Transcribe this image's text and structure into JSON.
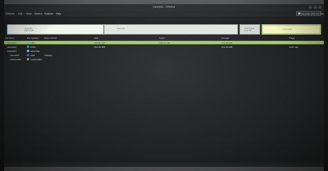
{
  "window": {
    "title": "/dev/sdb - GParted"
  },
  "menu": [
    "GParted",
    "Edit",
    "View",
    "Device",
    "Partition",
    "Help"
  ],
  "device": {
    "label": "/dev/sdb (931.51 GiB)"
  },
  "diskmap": {
    "partitions": [
      {
        "name": "/dev/sdb1",
        "size": "476.91 GiB"
      },
      {
        "name": "/dev/sdb2",
        "size": "...."
      },
      {
        "name": "unallocated",
        "size": "5.15 GiB"
      },
      {
        "name": "unallocated",
        "size": ""
      }
    ]
  },
  "table": {
    "headers": [
      "Partition",
      "File System",
      "Mount Point",
      "Size",
      "Used",
      "Unused",
      "Flags"
    ],
    "rows": [
      {
        "partition": "/dev/sdb1",
        "filesystem": "ntfs",
        "mount": "",
        "size": "476.91 GiB",
        "used": "339.97 GiB",
        "unused": "137.00 GiB",
        "flags": "",
        "color": "#42d692"
      },
      {
        "partition": "/dev/sdb2",
        "filesystem": "fat32",
        "mount": "",
        "size": "512.00 MiB",
        "used": "",
        "unused": "511.00 GiB",
        "flags": "boot, esp",
        "color": "#18b6c8"
      },
      {
        "partition": "/dev/sdb3",
        "filesystem": "extended",
        "mount": "",
        "size": "",
        "used": "",
        "unused": "",
        "flags": "",
        "color": "#7ad1ea"
      },
      {
        "partition": "/dev/sdb5",
        "filesystem": "ext4",
        "mount": "/media/...",
        "size": "",
        "used": "",
        "unused": "",
        "flags": "",
        "color": "#2f6fd2"
      },
      {
        "partition": "unallocated",
        "filesystem": "unallocated",
        "mount": "",
        "size": "",
        "used": "",
        "unused": "",
        "flags": "",
        "color": "#a0a0a0"
      }
    ]
  }
}
